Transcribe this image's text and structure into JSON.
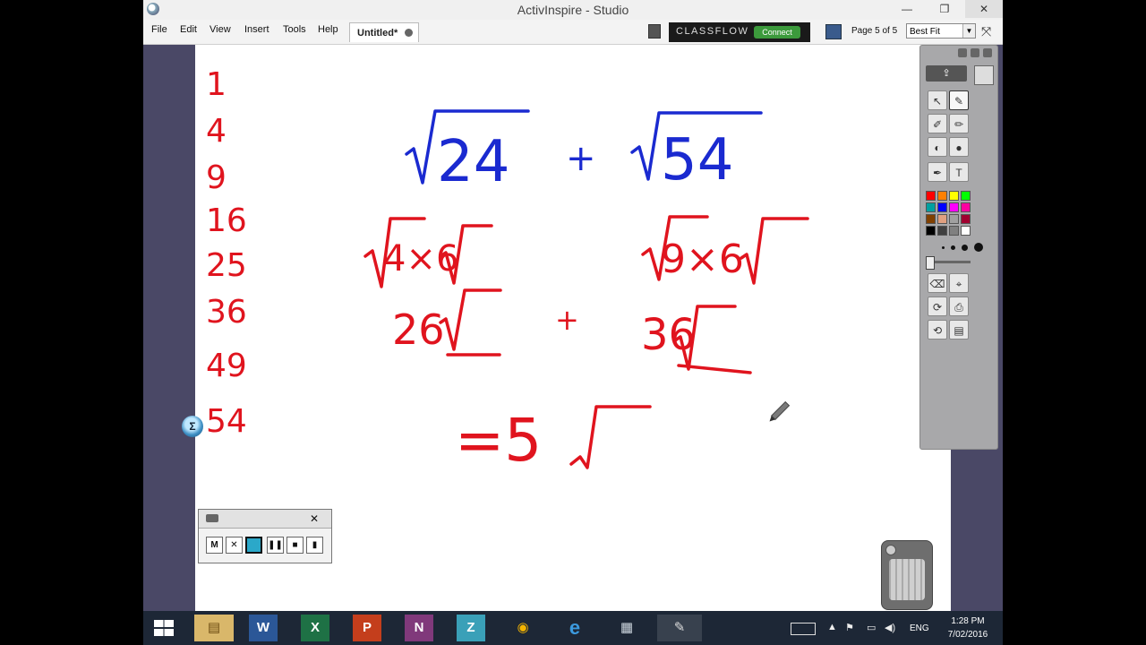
{
  "window": {
    "title": "ActivInspire - Studio",
    "minimize_glyph": "—",
    "restore_glyph": "❐",
    "close_glyph": "✕"
  },
  "menu": {
    "items": [
      "File",
      "Edit",
      "View",
      "Insert",
      "Tools",
      "Help"
    ],
    "document_tab": "Untitled*",
    "classflow_label": "CLASSFLOW",
    "classflow_connect": "Connect",
    "page_label": "Page 5 of 5",
    "zoom_value": "Best Fit"
  },
  "toolbox": {
    "share_glyph": "⇪",
    "palette": [
      "#ff0000",
      "#ff8000",
      "#ffff00",
      "#00ff00",
      "#00a0a0",
      "#0000ff",
      "#ff00ff",
      "#ff00a0",
      "#804000",
      "#e0a080",
      "#a0a0a0",
      "#a00030",
      "#000000",
      "#404040",
      "#808080",
      "#ffffff"
    ],
    "tools": [
      "↖",
      "✎",
      "✐",
      "✏",
      "◐",
      "●",
      "✒",
      "T",
      "⌫",
      "⌖",
      "⟳",
      "⎙",
      "⟲",
      "▤"
    ]
  },
  "canvas": {
    "ink_red": "#e0141e",
    "ink_blue": "#1a2ad0",
    "left_column": [
      "1",
      "4",
      "9",
      "16",
      "25",
      "36",
      "49",
      "54"
    ],
    "expr_top_left": "24",
    "expr_top_plus": "+",
    "expr_top_right": "54",
    "expr_mid_left": "4×6",
    "expr_mid_right": "9×6",
    "expr_low_left": "26",
    "expr_low_plus": "+",
    "expr_low_right": "36",
    "expr_result": "=5"
  },
  "recorder": {
    "close_glyph": "✕",
    "buttons": [
      "M",
      "✕",
      "",
      "❚❚",
      "■",
      "▮"
    ]
  },
  "marker_glyph": "Σ",
  "taskbar": {
    "apps": [
      "W",
      "X",
      "P",
      "N",
      "Z",
      "◉",
      "e",
      "▦",
      "✎"
    ],
    "tray_up": "▲",
    "tray_flag": "⚑",
    "tray_net": "▭",
    "tray_sound": "◀)",
    "language": "ENG",
    "time": "1:28 PM",
    "date": "7/02/2016"
  }
}
